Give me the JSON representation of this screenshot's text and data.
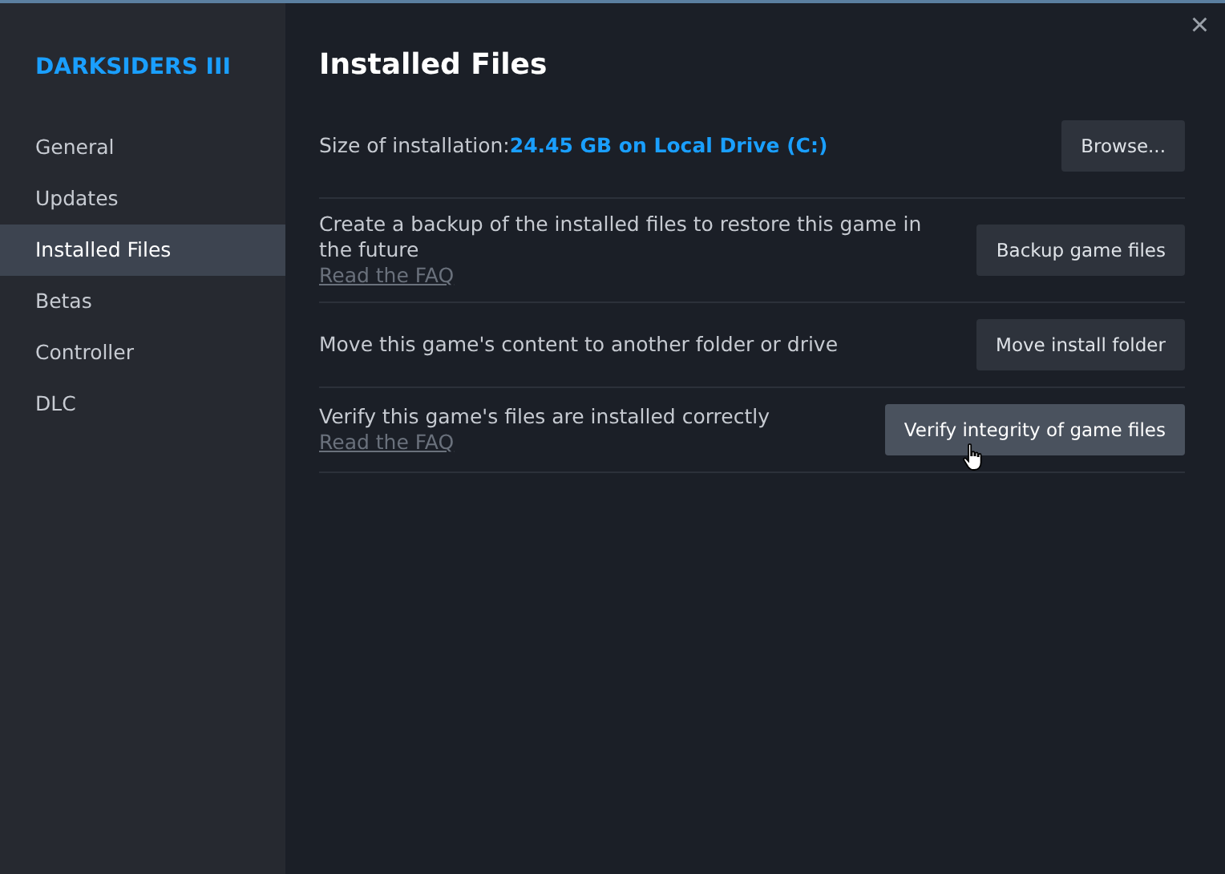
{
  "game_title": "DARKSIDERS III",
  "sidebar": {
    "items": [
      {
        "label": "General",
        "selected": false
      },
      {
        "label": "Updates",
        "selected": false
      },
      {
        "label": "Installed Files",
        "selected": true
      },
      {
        "label": "Betas",
        "selected": false
      },
      {
        "label": "Controller",
        "selected": false
      },
      {
        "label": "DLC",
        "selected": false
      }
    ]
  },
  "close": "×",
  "heading": "Installed Files",
  "size": {
    "label": "Size of installation:",
    "value": "24.45 GB on Local Drive (C:)",
    "button": {
      "label": "Browse...",
      "hovered": false
    }
  },
  "rows": [
    {
      "text": "Create a backup of the installed files to restore this game in the future",
      "link": "Read the FAQ",
      "button": {
        "label": "Backup game files",
        "hovered": false
      }
    },
    {
      "text": "Move this game's content to another folder or drive",
      "button": {
        "label": "Move install folder",
        "hovered": false
      }
    },
    {
      "text": "Verify this game's files are installed correctly",
      "link": "Read the FAQ",
      "button": {
        "label": "Verify integrity of game files",
        "hovered": true
      }
    }
  ]
}
